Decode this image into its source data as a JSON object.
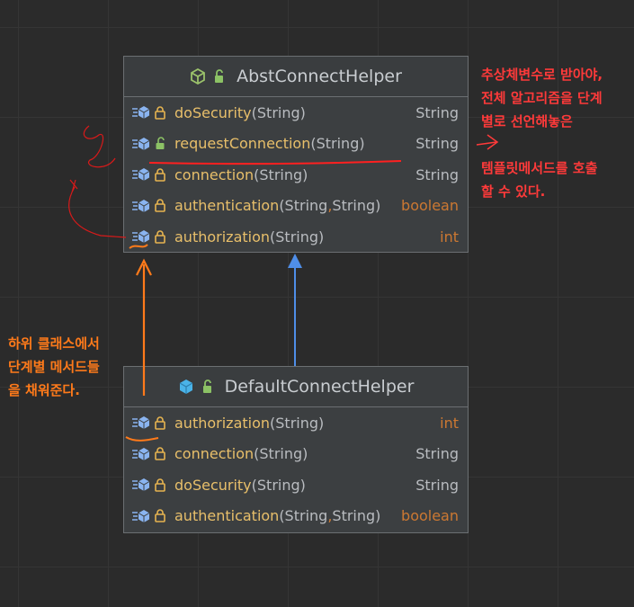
{
  "colors": {
    "method_name": "#e8bf6a",
    "keyword_type": "#cc7832",
    "text": "#b9bcc0",
    "annotation_red": "#ff3a3a",
    "annotation_orange": "#ff7a1a",
    "inheritance_arrow": "#4f8ee8"
  },
  "abstract_class": {
    "name": "AbstConnectHelper",
    "icon": "abstract-class-icon",
    "members": [
      {
        "name": "doSecurity",
        "params": "(String)",
        "params_after": "",
        "type": "String",
        "keyword_type": false,
        "icon": "method-icon",
        "lock": "lock-icon"
      },
      {
        "name": "requestConnection",
        "params": "(String)",
        "params_after": "",
        "type": "String",
        "keyword_type": false,
        "icon": "method-icon",
        "lock": "lock-open-icon"
      },
      {
        "name": "connection",
        "params": "(String)",
        "params_after": "",
        "type": "String",
        "keyword_type": false,
        "icon": "method-icon",
        "lock": "lock-icon"
      },
      {
        "name": "authentication ",
        "params": "(String",
        "params_after": " String)",
        "type": "boolean",
        "keyword_type": true,
        "icon": "method-icon",
        "lock": "lock-icon"
      },
      {
        "name": "authorization ",
        "params": "(String)",
        "params_after": "",
        "type": "int",
        "keyword_type": true,
        "icon": "method-icon",
        "lock": "lock-icon"
      }
    ]
  },
  "concrete_class": {
    "name": "DefaultConnectHelper",
    "icon": "class-icon",
    "members": [
      {
        "name": "authorization ",
        "params": "(String)",
        "params_after": "",
        "type": "int",
        "keyword_type": true,
        "icon": "method-icon",
        "lock": "lock-icon"
      },
      {
        "name": "connection",
        "params": "(String)",
        "params_after": "",
        "type": "String",
        "keyword_type": false,
        "icon": "method-icon",
        "lock": "lock-icon"
      },
      {
        "name": "doSecurity",
        "params": "(String)",
        "params_after": "",
        "type": "String",
        "keyword_type": false,
        "icon": "method-icon",
        "lock": "lock-icon"
      },
      {
        "name": "authentication ",
        "params": "(String",
        "params_after": " String)",
        "type": "boolean",
        "keyword_type": true,
        "icon": "method-icon",
        "lock": "lock-icon"
      }
    ]
  },
  "comma": ",",
  "notes": {
    "right": [
      "추상체변수로 받아야,",
      "전체 알고리즘을 단계",
      "별로 선언해놓은",
      "템플릿메서드를 호출",
      "할 수 있다."
    ],
    "left": [
      "하위 클래스에서",
      "단계별 메서드들",
      "을 채워준다."
    ]
  }
}
